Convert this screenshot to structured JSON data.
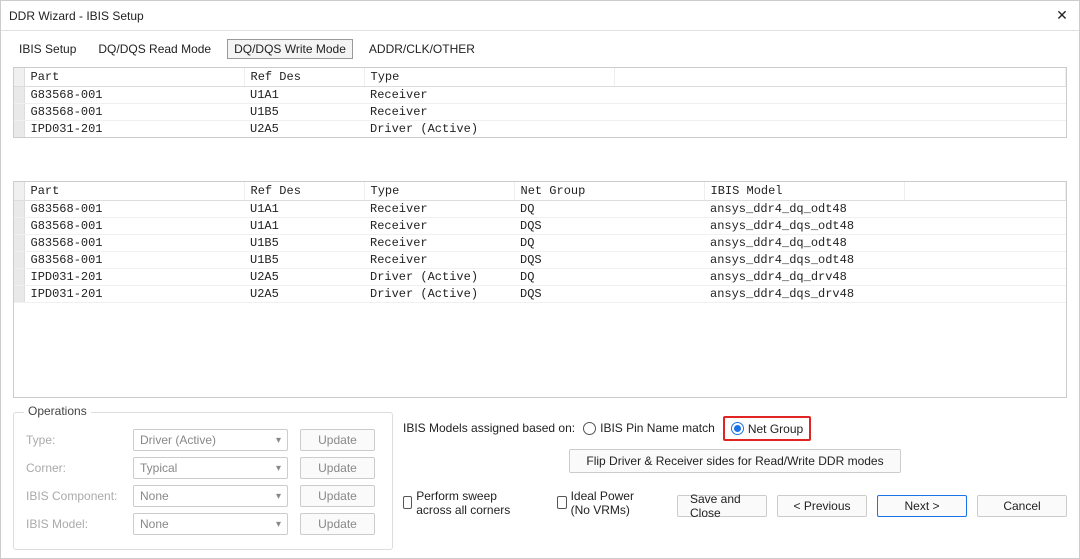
{
  "window": {
    "title": "DDR Wizard - IBIS Setup"
  },
  "tabs": {
    "items": [
      "IBIS Setup",
      "DQ/DQS Read Mode",
      "DQ/DQS Write Mode",
      "ADDR/CLK/OTHER"
    ],
    "active_index": 2
  },
  "table1": {
    "headers": [
      "Part",
      "Ref Des",
      "Type"
    ],
    "rows": [
      {
        "part": "G83568-001",
        "refdes": "U1A1",
        "type": "Receiver"
      },
      {
        "part": "G83568-001",
        "refdes": "U1B5",
        "type": "Receiver"
      },
      {
        "part": "IPD031-201",
        "refdes": "U2A5",
        "type": "Driver (Active)"
      }
    ]
  },
  "table2": {
    "headers": [
      "Part",
      "Ref Des",
      "Type",
      "Net Group",
      "IBIS Model"
    ],
    "rows": [
      {
        "part": "G83568-001",
        "refdes": "U1A1",
        "type": "Receiver",
        "netgroup": "DQ",
        "model": "ansys_ddr4_dq_odt48"
      },
      {
        "part": "G83568-001",
        "refdes": "U1A1",
        "type": "Receiver",
        "netgroup": "DQS",
        "model": "ansys_ddr4_dqs_odt48"
      },
      {
        "part": "G83568-001",
        "refdes": "U1B5",
        "type": "Receiver",
        "netgroup": "DQ",
        "model": "ansys_ddr4_dq_odt48"
      },
      {
        "part": "G83568-001",
        "refdes": "U1B5",
        "type": "Receiver",
        "netgroup": "DQS",
        "model": "ansys_ddr4_dqs_odt48"
      },
      {
        "part": "IPD031-201",
        "refdes": "U2A5",
        "type": "Driver (Active)",
        "netgroup": "DQ",
        "model": "ansys_ddr4_dq_drv48"
      },
      {
        "part": "IPD031-201",
        "refdes": "U2A5",
        "type": "Driver (Active)",
        "netgroup": "DQS",
        "model": "ansys_ddr4_dqs_drv48"
      }
    ]
  },
  "operations": {
    "title": "Operations",
    "rows": [
      {
        "label": "Type:",
        "value": "Driver (Active)",
        "button": "Update"
      },
      {
        "label": "Corner:",
        "value": "Typical",
        "button": "Update"
      },
      {
        "label": "IBIS Component:",
        "value": "None",
        "button": "Update"
      },
      {
        "label": "IBIS Model:",
        "value": "None",
        "button": "Update"
      }
    ]
  },
  "assign": {
    "label": "IBIS Models assigned based on:",
    "opt_pin": "IBIS Pin Name match",
    "opt_net": "Net Group",
    "selected": "net"
  },
  "flip_button": "Flip Driver & Receiver sides for Read/Write DDR modes",
  "check_sweep": "Perform sweep across all corners",
  "check_ideal": "Ideal Power (No VRMs)",
  "footer": {
    "save": "Save and Close",
    "prev": "< Previous",
    "next": "Next >",
    "cancel": "Cancel"
  }
}
